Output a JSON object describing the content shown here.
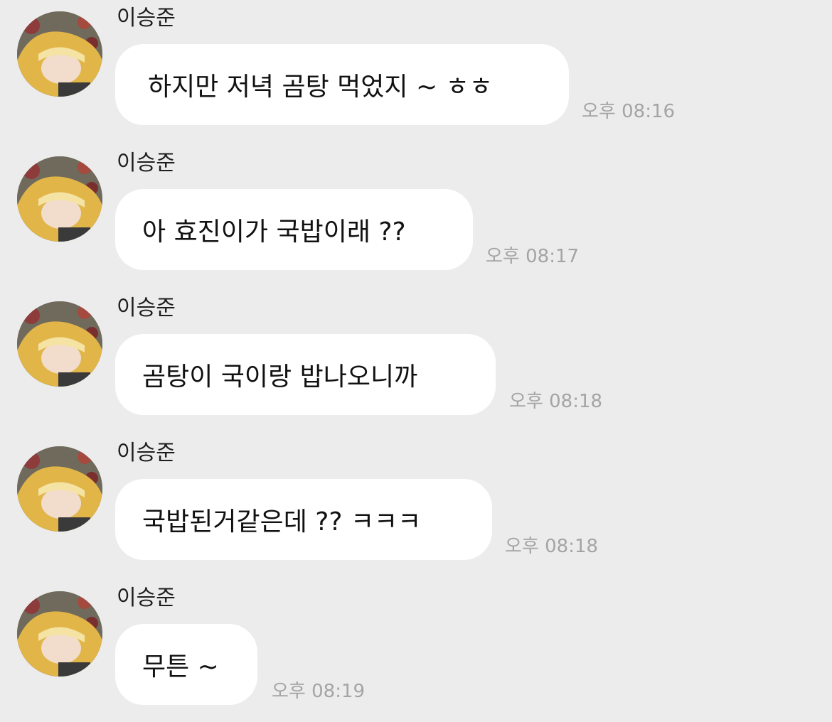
{
  "messages": [
    {
      "sender": "이승준",
      "text": "하지만 저녁 곰탕 먹었지 ~ ㅎㅎ",
      "time": "오후 08:16"
    },
    {
      "sender": "이승준",
      "text": "아 효진이가 국밥이래 ??",
      "time": "오후 08:17"
    },
    {
      "sender": "이승준",
      "text": "곰탕이 국이랑 밥나오니까",
      "time": "오후 08:18"
    },
    {
      "sender": "이승준",
      "text": "국밥된거같은데 ?? ㅋㅋㅋ",
      "time": "오후 08:18"
    },
    {
      "sender": "이승준",
      "text": "무튼 ~",
      "time": "오후 08:19"
    }
  ],
  "colors": {
    "background": "#ececec",
    "bubble": "#ffffff",
    "timestamp": "#a4a4a4"
  }
}
